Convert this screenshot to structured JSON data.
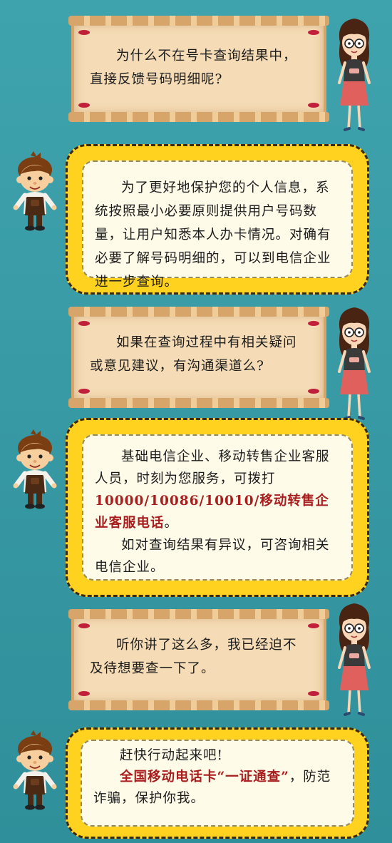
{
  "dialog": [
    {
      "role": "question",
      "text": "为什么不在号卡查询结果中，直接反馈号码明细呢?"
    },
    {
      "role": "answer",
      "paragraphs": [
        {
          "text": "为了更好地保护您的个人信息，系统按照最小必要原则提供用户号码数量，让用户知悉本人办卡情况。对确有必要了解号码明细的，可以到电信企业进一步查询。"
        }
      ]
    },
    {
      "role": "question",
      "text": "如果在查询过程中有相关疑问或意见建议，有沟通渠道么?"
    },
    {
      "role": "answer",
      "paragraphs": [
        {
          "text_a": "基础电信企业、移动转售企业客服人员，时刻为您服务，可拨打",
          "highlight": "10000/10086/10010/移动转售企业客服电话",
          "text_b": "。"
        },
        {
          "text": "如对查询结果有异议，可咨询相关电信企业。"
        }
      ]
    },
    {
      "role": "question",
      "text": "听你讲了这么多，我已经迫不及待想要查一下了。"
    },
    {
      "role": "answer",
      "paragraphs": [
        {
          "text": "赶快行动起来吧!"
        },
        {
          "highlight": "全国移动电话卡“一证通查”",
          "text_b": "，防范诈骗，保护你我。"
        }
      ]
    }
  ],
  "colors": {
    "background": "#3fa3ad",
    "parchment": "#f5dcb6",
    "bubble": "#ffd21f",
    "highlight_text": "#a81e1e"
  },
  "characters": {
    "girl": "girl-with-glasses-character",
    "boy": "boy-character"
  }
}
